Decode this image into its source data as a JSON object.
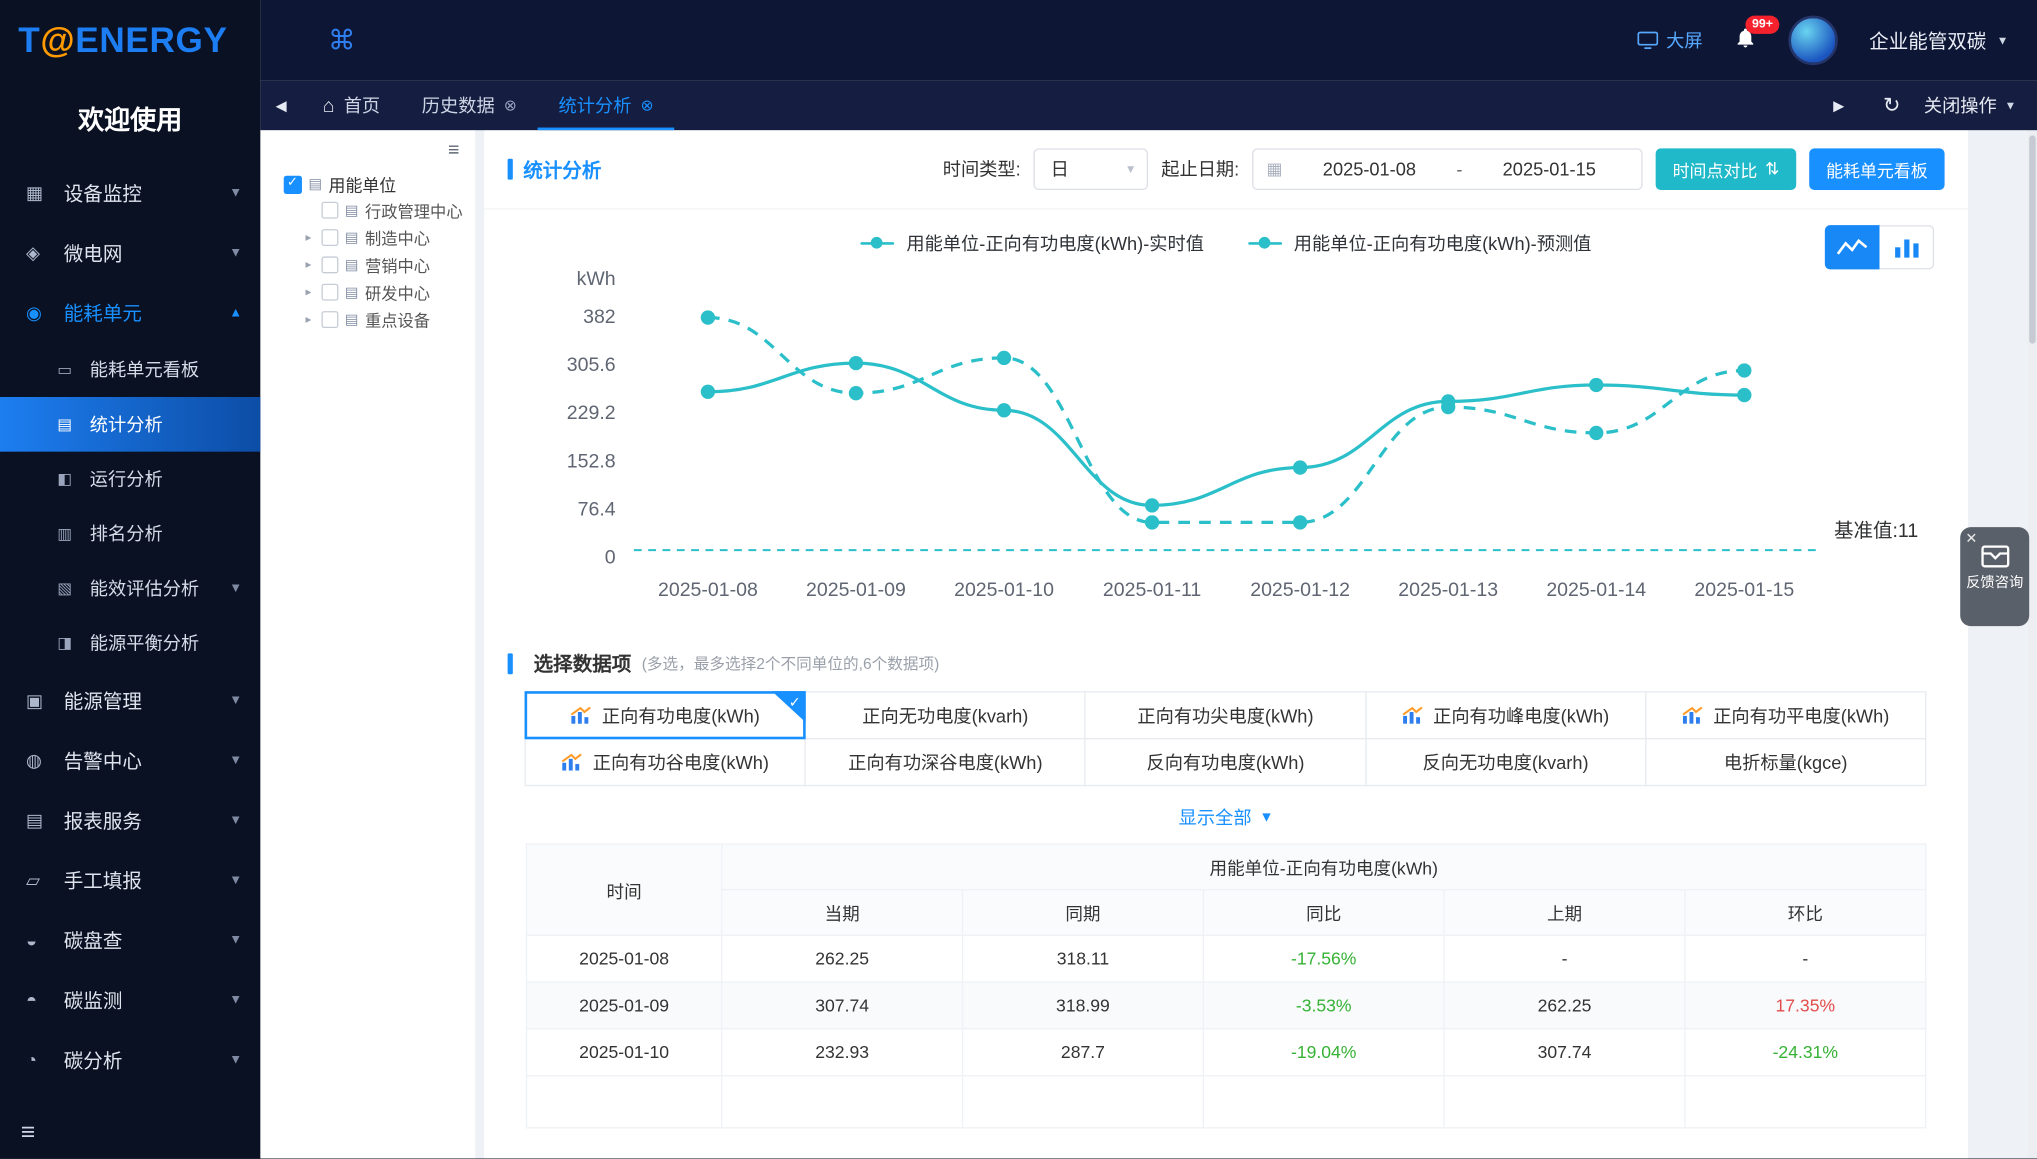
{
  "brand": {
    "logo": {
      "t": "T",
      "at": "@",
      "rest": "ENERGY"
    },
    "welcome": "欢迎使用"
  },
  "sidebar": {
    "items": [
      {
        "label": "设备监控",
        "icon": "device-monitoring"
      },
      {
        "label": "微电网",
        "icon": "microgrid"
      },
      {
        "label": "能耗单元",
        "icon": "energy-unit",
        "active": true,
        "expanded": true
      },
      {
        "label": "能源管理",
        "icon": "energy-management"
      },
      {
        "label": "告警中心",
        "icon": "alarm-center"
      },
      {
        "label": "报表服务",
        "icon": "report-service"
      },
      {
        "label": "手工填报",
        "icon": "manual-report"
      },
      {
        "label": "碳盘查",
        "icon": "carbon-audit"
      },
      {
        "label": "碳监测",
        "icon": "carbon-monitoring"
      },
      {
        "label": "碳分析",
        "icon": "carbon-analysis"
      }
    ],
    "submenu": [
      {
        "label": "能耗单元看板"
      },
      {
        "label": "统计分析",
        "active": true
      },
      {
        "label": "运行分析"
      },
      {
        "label": "排名分析"
      },
      {
        "label": "能效评估分析",
        "expandable": true
      },
      {
        "label": "能源平衡分析"
      }
    ]
  },
  "header": {
    "big_screen": "大屏",
    "badge": "99+",
    "org": "企业能管双碳"
  },
  "tabs": {
    "home": "首页",
    "items": [
      {
        "label": "历史数据"
      },
      {
        "label": "统计分析",
        "active": true
      }
    ],
    "close_ops": "关闭操作"
  },
  "tree": {
    "root": "用能单位",
    "children": [
      "行政管理中心",
      "制造中心",
      "营销中心",
      "研发中心",
      "重点设备"
    ]
  },
  "toolbar": {
    "title": "统计分析",
    "time_type_label": "时间类型:",
    "time_type_value": "日",
    "date_label": "起止日期:",
    "date_start": "2025-01-08",
    "date_separator": "-",
    "date_end": "2025-01-15",
    "compare_button": "时间点对比",
    "board_button": "能耗单元看板"
  },
  "chart_data": {
    "type": "line",
    "ylabel": "kWh",
    "x": [
      "2025-01-08",
      "2025-01-09",
      "2025-01-10",
      "2025-01-11",
      "2025-01-12",
      "2025-01-13",
      "2025-01-14",
      "2025-01-15"
    ],
    "yticks": [
      0,
      76.4,
      152.8,
      229.2,
      305.6,
      382
    ],
    "ylim": [
      0,
      382
    ],
    "grid": false,
    "legend_position": "top",
    "series": [
      {
        "name": "用能单位-正向有功电度(kWh)-实时值",
        "style": "solid",
        "color": "#2bbfc9",
        "values": [
          262.25,
          307.74,
          232.93,
          82,
          142,
          247,
          273,
          257
        ]
      },
      {
        "name": "用能单位-正向有功电度(kWh)-预测值",
        "style": "dashed",
        "color": "#2bbfc9",
        "values": [
          380,
          260,
          316,
          55,
          55,
          238,
          197,
          296
        ]
      }
    ],
    "baseline": {
      "label": "基准值:11",
      "value": 11
    }
  },
  "selector": {
    "title": "选择数据项",
    "note": "(多选，最多选择2个不同单位的,6个数据项)",
    "show_all": "显示全部",
    "items": [
      {
        "label": "正向有功电度(kWh)",
        "selected": true,
        "icon": true
      },
      {
        "label": "正向无功电度(kvarh)"
      },
      {
        "label": "正向有功尖电度(kWh)"
      },
      {
        "label": "正向有功峰电度(kWh)",
        "icon": true
      },
      {
        "label": "正向有功平电度(kWh)",
        "icon": true
      },
      {
        "label": "正向有功谷电度(kWh)",
        "icon": true
      },
      {
        "label": "正向有功深谷电度(kWh)"
      },
      {
        "label": "反向有功电度(kWh)"
      },
      {
        "label": "反向无功电度(kvarh)"
      },
      {
        "label": "电折标量(kgce)"
      }
    ]
  },
  "table": {
    "time_header": "时间",
    "group_header": "用能单位-正向有功电度(kWh)",
    "sub_headers": [
      "当期",
      "同期",
      "同比",
      "上期",
      "环比"
    ],
    "rows": [
      {
        "date": "2025-01-08",
        "current": "262.25",
        "same": "318.11",
        "yoy": "-17.56%",
        "yoy_color": "#35b234",
        "prev": "-",
        "mom": "-"
      },
      {
        "date": "2025-01-09",
        "current": "307.74",
        "same": "318.99",
        "yoy": "-3.53%",
        "yoy_color": "#35b234",
        "prev": "262.25",
        "mom": "17.35%",
        "mom_color": "#e24c4c"
      },
      {
        "date": "2025-01-10",
        "current": "232.93",
        "same": "287.7",
        "yoy": "-19.04%",
        "yoy_color": "#35b234",
        "prev": "307.74",
        "mom": "-24.31%",
        "mom_color": "#35b234"
      }
    ]
  },
  "feedback": {
    "label": "反馈咨询"
  },
  "colors": {
    "accent": "#1890ff",
    "teal_button": "#1fb9c9",
    "series": "#2bbfc9",
    "up_red": "#e24c4c",
    "down_green": "#35b234"
  }
}
